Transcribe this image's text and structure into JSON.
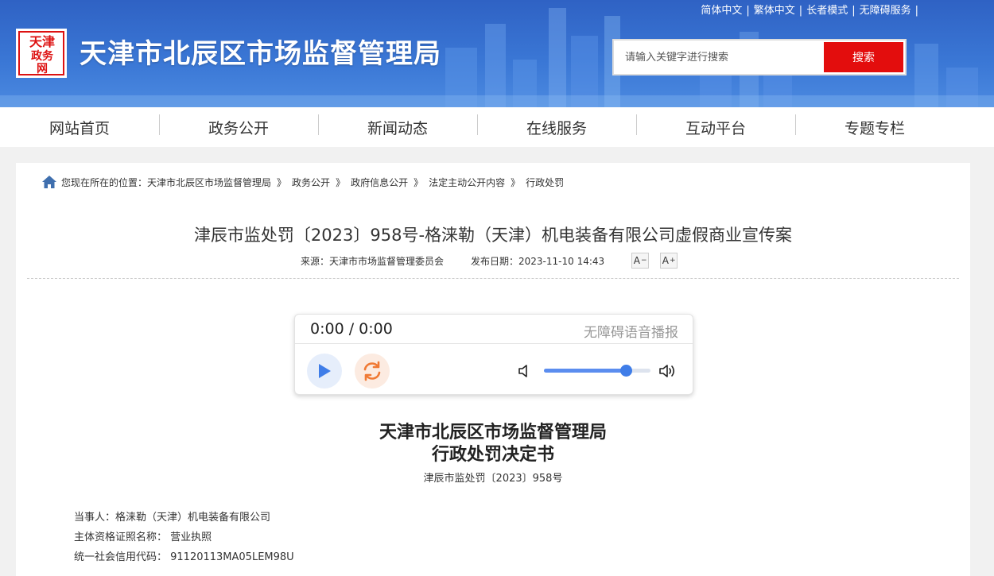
{
  "header": {
    "top_links": [
      "简体中文",
      "繁体中文",
      "长者模式",
      "无障碍服务"
    ],
    "logo_text": [
      "天津",
      "政务",
      "网"
    ],
    "site_title": "天津市北辰区市场监督管理局",
    "search": {
      "placeholder": "请输入关键字进行搜索",
      "button_label": "搜索"
    }
  },
  "nav": {
    "items": [
      "网站首页",
      "政务公开",
      "新闻动态",
      "在线服务",
      "互动平台",
      "专题专栏"
    ]
  },
  "breadcrumb": {
    "prefix": "您现在所在的位置：",
    "items": [
      "天津市北辰区市场监督管理局",
      "政务公开",
      "政府信息公开",
      "法定主动公开内容",
      "行政处罚"
    ],
    "separator": "》"
  },
  "article": {
    "title": "津辰市监处罚〔2023〕958号-格涞勒（天津）机电装备有限公司虚假商业宣传案",
    "source": "来源：天津市市场监督管理委员会",
    "date": "发布日期：2023-11-10 14:43",
    "font_decrease": "A",
    "font_increase": "A"
  },
  "player": {
    "time": "0:00 / 0:00",
    "label": "无障碍语音播报",
    "volume_fraction": 0.77,
    "icons": [
      "play-icon",
      "replay-icon",
      "mute-icon",
      "volume-icon"
    ]
  },
  "document": {
    "heading_line1": "天津市北辰区市场监督管理局",
    "heading_line2": "行政处罚决定书",
    "doc_number": "津辰市监处罚〔2023〕958号",
    "fields": [
      "当事人：格涞勒（天津）机电装备有限公司",
      "主体资格证照名称： 营业执照",
      "统一社会信用代码： 91120113MA05LEM98U"
    ]
  },
  "colors": {
    "header_blue": "#3b78d6",
    "search_button_red": "#e30d0d",
    "player_accent": "#3f7de8",
    "replay_orange": "#f07a35"
  }
}
